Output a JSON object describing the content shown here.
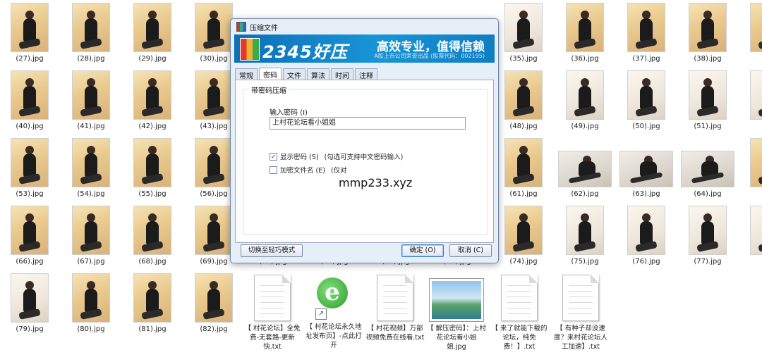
{
  "row1": [
    "(27).jpg",
    "(28).jpg",
    "(29).jpg",
    "(30).jpg",
    "(35).jpg",
    "(36).jpg",
    "(37).jpg",
    "(38).jpg",
    "(39"
  ],
  "row2": [
    "(40).jpg",
    "(41).jpg",
    "(42).jpg",
    "(43).jpg",
    "(48).jpg",
    "(49).jpg",
    "(50).jpg",
    "(51).jpg",
    "(52"
  ],
  "row3": [
    "(53).jpg",
    "(54).jpg",
    "(55).jpg",
    "(56).jpg",
    "(61).jpg",
    "(62).jpg",
    "(63).jpg",
    "(64).jpg",
    "(65"
  ],
  "row4": [
    "(66).jpg",
    "(67).jpg",
    "(68).jpg",
    "(69).jpg",
    "(70).jpg",
    "(71).jpg",
    "(72).jpg",
    "(73).jpg",
    "(74).jpg",
    "(75).jpg",
    "(76).jpg",
    "(77).jpg",
    "(78"
  ],
  "row5": [
    "(79).jpg",
    "(80).jpg",
    "(81).jpg",
    "(82).jpg"
  ],
  "files": [
    "【 村花论坛】全免费-无套路-更新快.txt",
    "【 村花论坛永久地址发布页】-点此打开",
    "【 村花视频】万部视频免费在线看.txt",
    "【 解压密码】：上村花论坛看小姐姐.jpg",
    "【 来了就能下载的论坛，纯免费！】.txt",
    "【 有种子却没速度？来村花论坛人工加速】.txt"
  ],
  "dialog": {
    "title": "压缩文件",
    "brand": "2345好压",
    "slogan": "高效专业，值得信赖",
    "subslogan": "A股上市公司荣誉出品 (股票代码：002195)",
    "tabs": [
      "常规",
      "密码",
      "文件",
      "算法",
      "时间",
      "注释"
    ],
    "group_title": "带密码压缩",
    "password_label": "输入密码 (I)",
    "password_value": "上村花论坛看小姐姐",
    "show_password_label": "显示密码 (S)",
    "show_password_hint": "(勾选可支持中文密码输入)",
    "encrypt_names_label": "加密文件名 (E)",
    "encrypt_names_hint": "(仅对",
    "switch_button": "切换至轻巧模式",
    "ok_button": "确定 (O)",
    "cancel_button": "取消 (C)"
  },
  "watermark": "mmp233.xyz"
}
